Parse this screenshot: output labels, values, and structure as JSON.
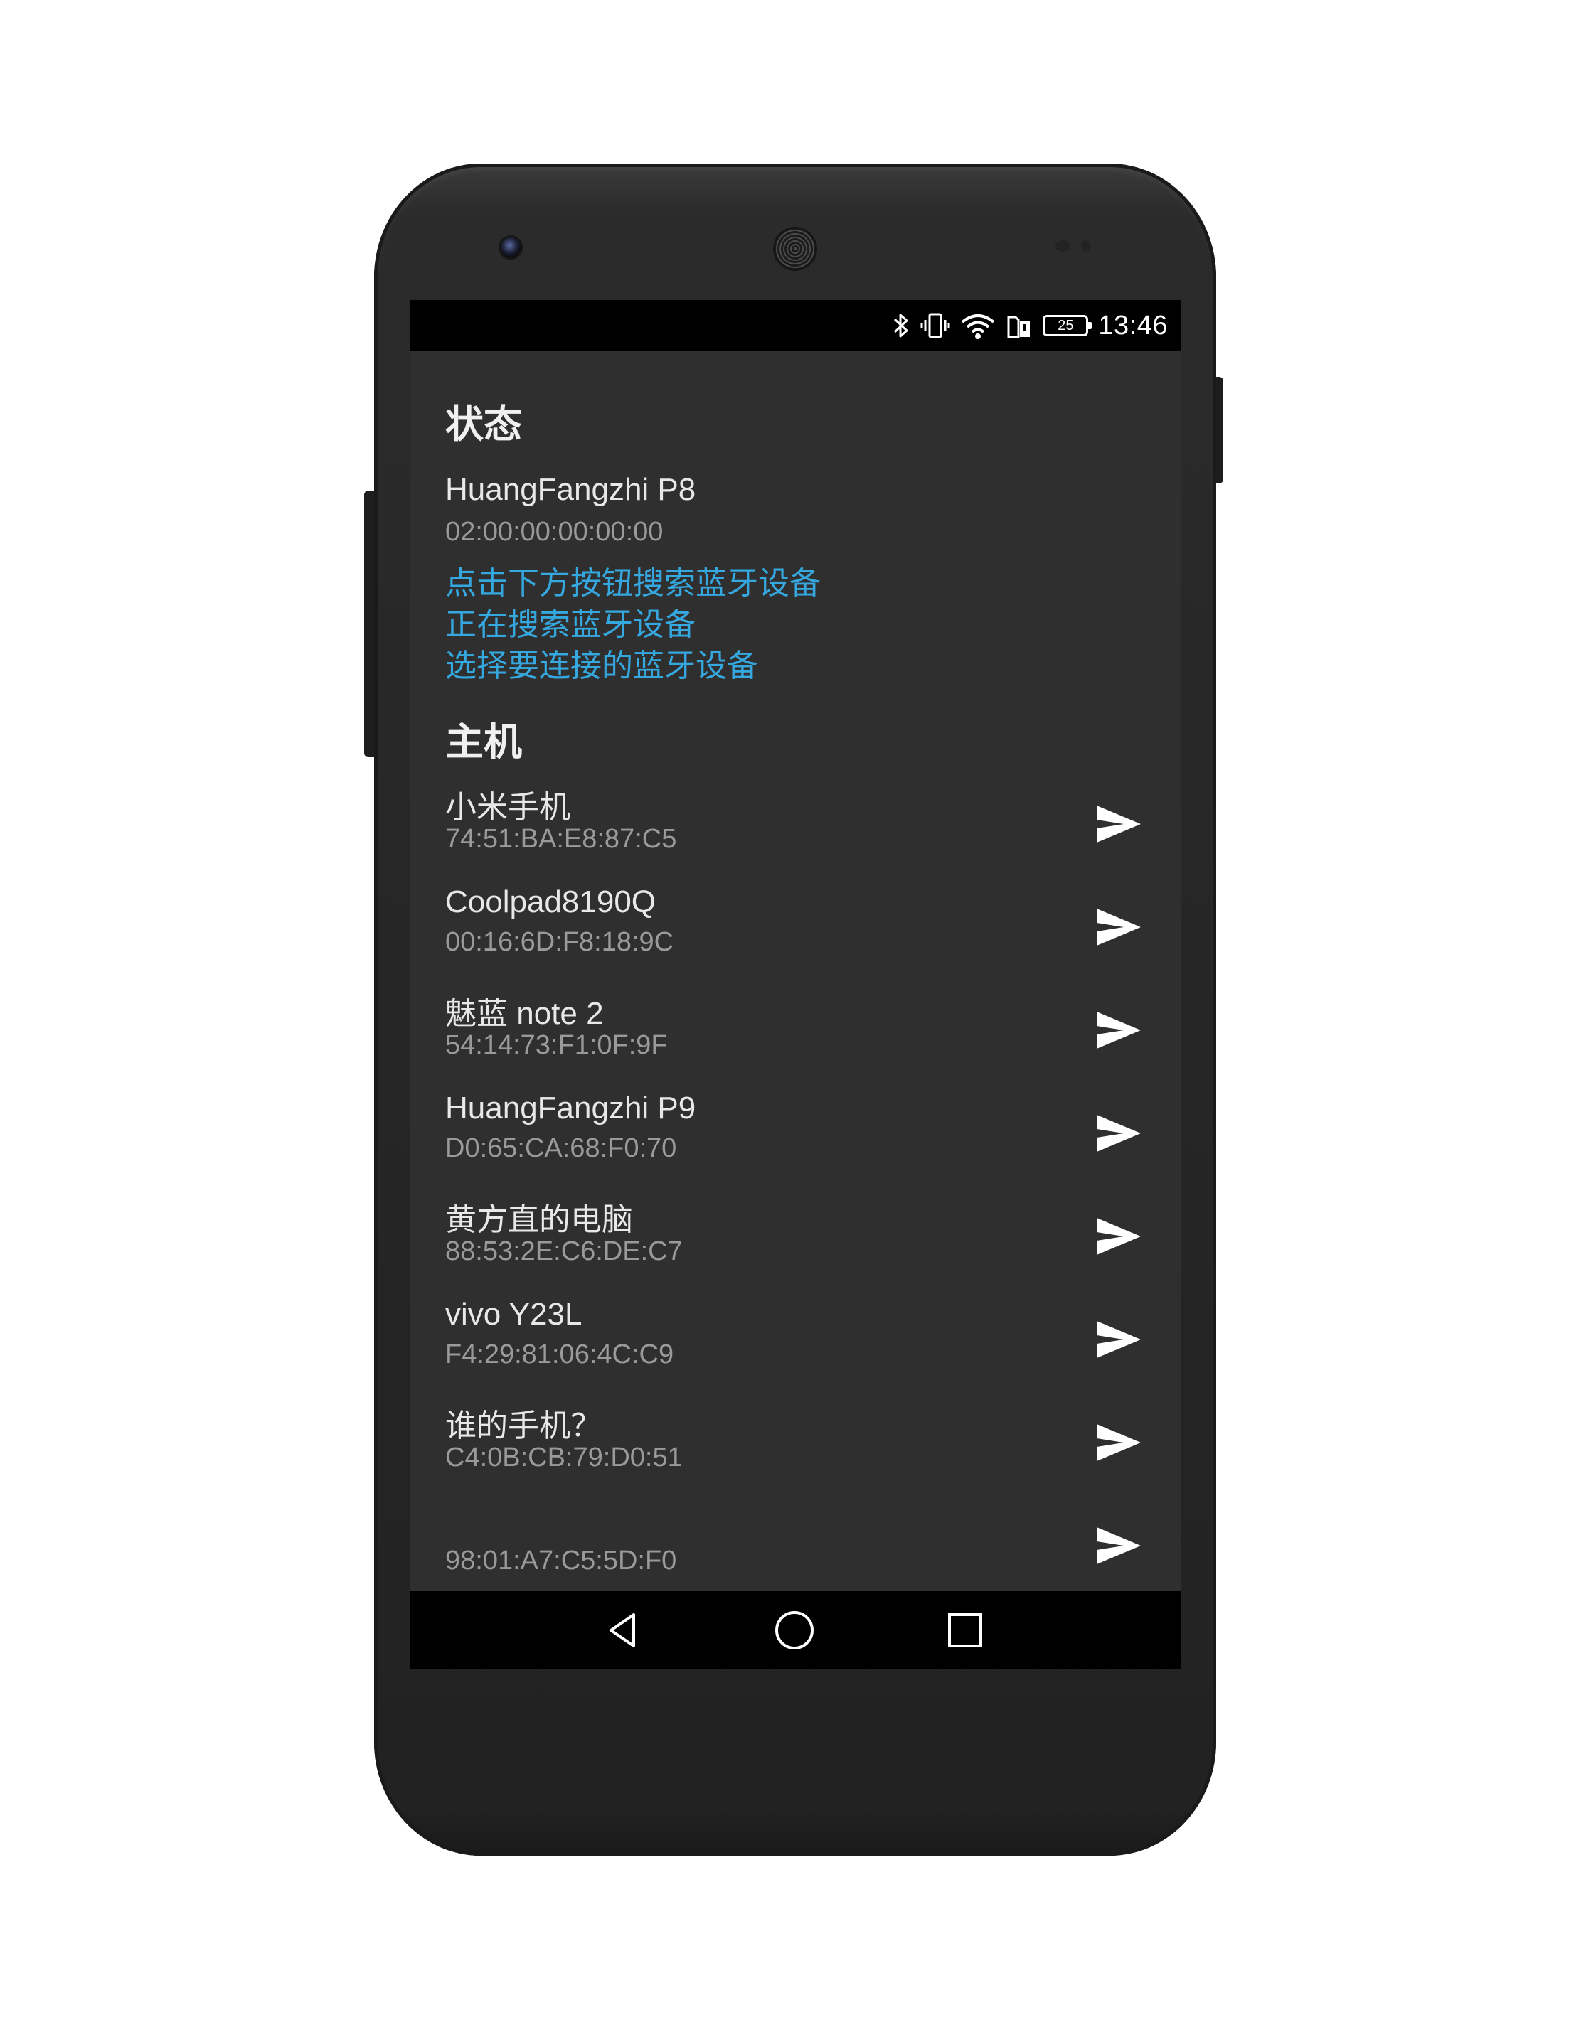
{
  "status_bar": {
    "time": "13:46",
    "battery": "25",
    "icons": [
      "bluetooth-icon",
      "vibrate-icon",
      "wifi-icon",
      "sim-icon",
      "battery-icon"
    ]
  },
  "status_section": {
    "title": "状态",
    "local_device": {
      "name": "HuangFangzhi P8",
      "address": "02:00:00:00:00:00"
    },
    "messages": [
      "点击下方按钮搜索蓝牙设备",
      "正在搜索蓝牙设备",
      "选择要连接的蓝牙设备"
    ],
    "message_color": "#35a8e0"
  },
  "host_section": {
    "title": "主机",
    "devices": [
      {
        "name": "小米手机",
        "address": "74:51:BA:E8:87:C5"
      },
      {
        "name": "Coolpad8190Q",
        "address": "00:16:6D:F8:18:9C"
      },
      {
        "name": "魅蓝 note 2",
        "address": "54:14:73:F1:0F:9F"
      },
      {
        "name": "HuangFangzhi P9",
        "address": "D0:65:CA:68:F0:70"
      },
      {
        "name": "黄方直的电脑",
        "address": "88:53:2E:C6:DE:C7"
      },
      {
        "name": "vivo Y23L",
        "address": "F4:29:81:06:4C:C9"
      },
      {
        "name": "谁的手机？",
        "address": "C4:0B:CB:79:D0:51"
      },
      {
        "name": "",
        "address": "98:01:A7:C5:5D:F0"
      }
    ]
  },
  "nav_bar": {
    "buttons": [
      "back-icon",
      "home-icon",
      "recents-icon"
    ]
  }
}
